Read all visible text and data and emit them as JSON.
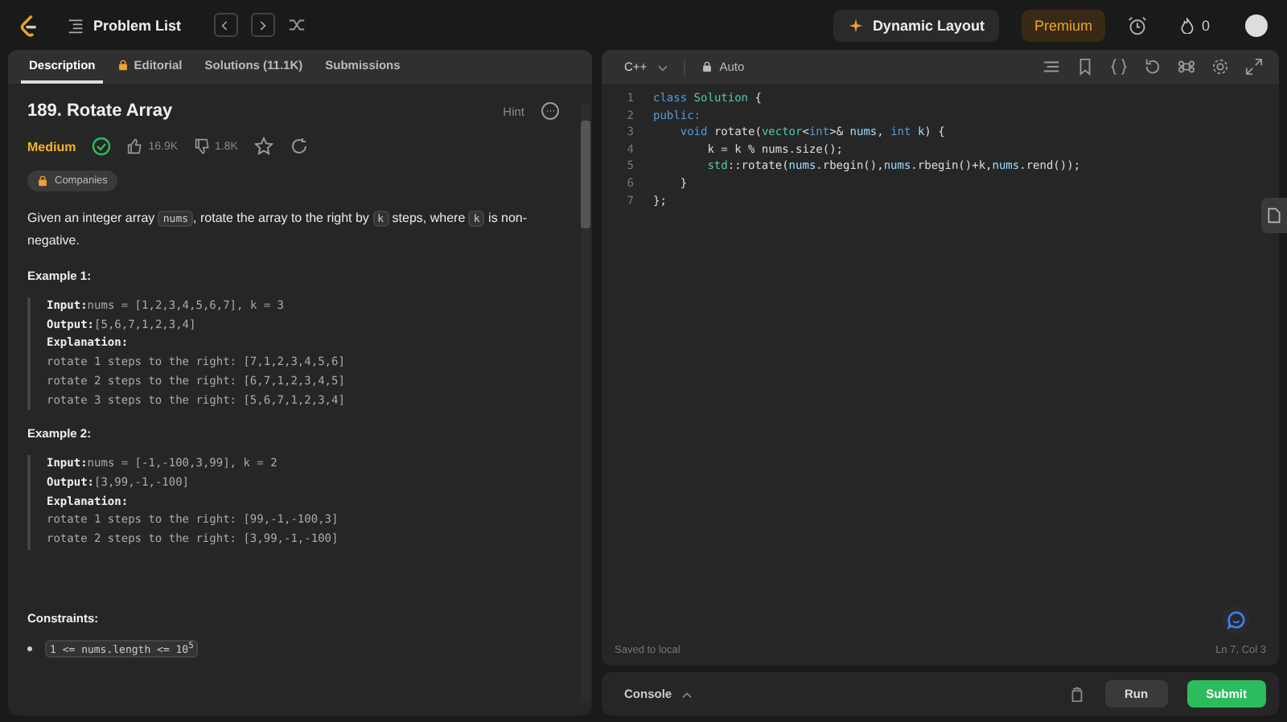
{
  "topbar": {
    "problem_list": "Problem List",
    "dynamic_layout": "Dynamic Layout",
    "premium": "Premium",
    "streak": "0"
  },
  "tabs": [
    {
      "label": "Description",
      "selected": true,
      "locked": false
    },
    {
      "label": "Editorial",
      "selected": false,
      "locked": true
    },
    {
      "label": "Solutions (11.1K)",
      "selected": false,
      "locked": false
    },
    {
      "label": "Submissions",
      "selected": false,
      "locked": false
    }
  ],
  "problem": {
    "title": "189. Rotate Array",
    "hint": "Hint",
    "difficulty": "Medium",
    "solved": true,
    "likes": "16.9K",
    "dislikes": "1.8K",
    "companies": "Companies",
    "description": [
      {
        "kind": "text",
        "text": "Given an integer array "
      },
      {
        "kind": "code",
        "text": "nums"
      },
      {
        "kind": "text",
        "text": ", rotate the array to the right by "
      },
      {
        "kind": "code",
        "text": "k"
      },
      {
        "kind": "text",
        "text": " steps, where "
      },
      {
        "kind": "code",
        "text": "k"
      },
      {
        "kind": "text",
        "text": " is non-negative."
      }
    ],
    "examples": [
      {
        "title": "Example 1:",
        "lines": [
          {
            "label": "Input:",
            "text": "nums = [1,2,3,4,5,6,7], k = 3"
          },
          {
            "label": "Output:",
            "text": "[5,6,7,1,2,3,4]"
          },
          {
            "label": "Explanation:"
          },
          {
            "text": "rotate 1 steps to the right: [7,1,2,3,4,5,6]"
          },
          {
            "text": "rotate 2 steps to the right: [6,7,1,2,3,4,5]"
          },
          {
            "text": "rotate 3 steps to the right: [5,6,7,1,2,3,4]"
          }
        ]
      },
      {
        "title": "Example 2:",
        "lines": [
          {
            "label": "Input:",
            "text": "nums = [-1,-100,3,99], k = 2"
          },
          {
            "label": "Output:",
            "text": "[3,99,-1,-100]"
          },
          {
            "label": "Explanation:"
          },
          {
            "text": "rotate 1 steps to the right: [99,-1,-100,3]"
          },
          {
            "text": "rotate 2 steps to the right: [3,99,-1,-100]"
          }
        ]
      }
    ],
    "constraints_title": "Constraints:",
    "constraints": [
      "1 <= nums.length <= 10$^{5}$"
    ]
  },
  "editor": {
    "language": "C++",
    "mode": "Auto",
    "code": [
      [
        {
          "kind": "kw",
          "text": "class "
        },
        {
          "kind": "type",
          "text": "Solution"
        },
        {
          "kind": "p",
          "text": " {"
        }
      ],
      [
        {
          "kind": "kw",
          "text": "public:"
        }
      ],
      [
        {
          "kind": "kw",
          "text": "    void "
        },
        {
          "kind": "p",
          "text": "rotate("
        },
        {
          "kind": "type",
          "text": "vector"
        },
        {
          "kind": "p",
          "text": "<"
        },
        {
          "kind": "kw",
          "text": "int"
        },
        {
          "kind": "p",
          "text": ">& "
        },
        {
          "kind": "var",
          "text": "nums"
        },
        {
          "kind": "p",
          "text": ", "
        },
        {
          "kind": "kw",
          "text": "int "
        },
        {
          "kind": "var",
          "text": "k"
        },
        {
          "kind": "p",
          "text": ") {"
        }
      ],
      [
        {
          "kind": "p",
          "text": "        k = k % nums.size();"
        }
      ],
      [
        {
          "kind": "type",
          "text": "        std"
        },
        {
          "kind": "p",
          "text": "::rotate("
        },
        {
          "kind": "var",
          "text": "nums"
        },
        {
          "kind": "p",
          "text": ".rbegin(),"
        },
        {
          "kind": "var",
          "text": "nums"
        },
        {
          "kind": "p",
          "text": ".rbegin()+k,"
        },
        {
          "kind": "var",
          "text": "nums"
        },
        {
          "kind": "p",
          "text": ".rend());"
        }
      ],
      [
        {
          "kind": "p",
          "text": "    }"
        }
      ],
      [
        {
          "kind": "p",
          "text": "};"
        }
      ]
    ],
    "line_numbers": [
      "1",
      "2",
      "3",
      "4",
      "5",
      "6",
      "7"
    ],
    "status": "Saved to local",
    "cursor": "Ln 7, Col 3"
  },
  "console": {
    "label": "Console",
    "run": "Run",
    "submit": "Submit"
  }
}
